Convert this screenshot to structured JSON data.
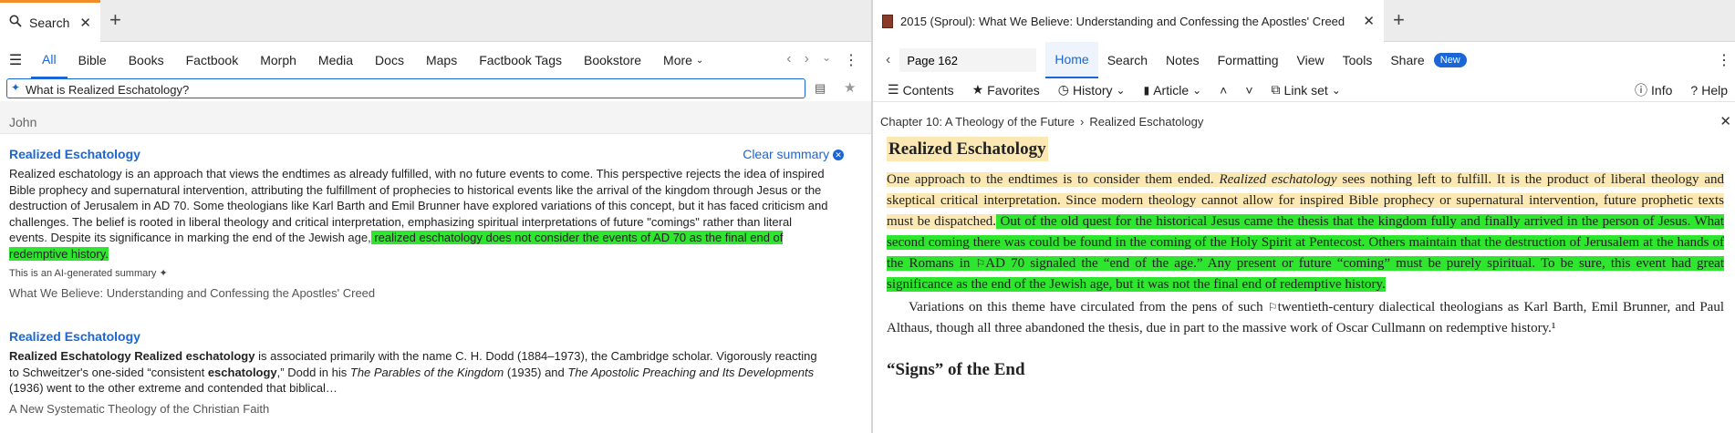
{
  "left_panel": {
    "tab": {
      "title": "Search"
    },
    "nav": {
      "items": [
        "All",
        "Bible",
        "Books",
        "Factbook",
        "Morph",
        "Media",
        "Docs",
        "Maps",
        "Factbook Tags",
        "Bookstore"
      ],
      "more": "More"
    },
    "search": {
      "value": "What is Realized Eschatology?"
    },
    "prev_result_fragment": "John",
    "summary": {
      "title": "Realized Eschatology",
      "clear_label": "Clear summary",
      "body": "Realized eschatology is an approach that views the endtimes as already fulfilled, with no future events to come. This perspective rejects the idea of inspired Bible prophecy and supernatural intervention, attributing the fulfillment of prophecies to historical events like the arrival of the kingdom through Jesus or the destruction of Jerusalem in AD 70. Some theologians like Karl Barth and Emil Brunner have explored variations of this concept, but it has faced criticism and challenges. The belief is rooted in liberal theology and critical interpretation, emphasizing spiritual interpretations of future \"comings\" rather than literal events. Despite its significance in marking the end of the Jewish age,",
      "body_highlight": " realized eschatology does not consider the events of AD 70 as the final end of redemptive history.",
      "ai_note": "This is an AI-generated summary",
      "source": "What We Believe: Understanding and Confessing the Apostles' Creed"
    },
    "result2": {
      "title": "Realized Eschatology",
      "bold_lead": "Realized Eschatology Realized eschatology",
      "text1": " is associated primarily with the name C. H. Dodd (1884–1973), the Cambridge scholar. Vigorously reacting to Schweitzer's one-sided “consistent ",
      "bold2": "eschatology",
      "text2": ",” Dodd in his ",
      "italic1": "The Parables of the Kingdom",
      "text3": " (1935) and ",
      "italic2": "The Apostolic Preaching and Its Developments",
      "text4": " (1936) went to the other extreme and contended that biblical…",
      "source": "A New Systematic Theology of the Christian Faith"
    }
  },
  "right_panel": {
    "tab": {
      "title": "2015 (Sproul): What We Believe: Understanding and Confessing the Apostles' Creed"
    },
    "page_field": "Page 162",
    "menu": [
      "Home",
      "Search",
      "Notes",
      "Formatting",
      "View",
      "Tools",
      "Share"
    ],
    "new_badge": "New",
    "toolbar": {
      "contents": "Contents",
      "favorites": "Favorites",
      "history": "History",
      "article": "Article",
      "link_set": "Link set",
      "info": "Info",
      "help": "Help"
    },
    "breadcrumb": {
      "chapter": "Chapter 10: A Theology of the Future",
      "section": "Realized Eschatology"
    },
    "content": {
      "heading": "Realized Eschatology",
      "p1_y1": "One approach to the endtimes is to consider them ended. ",
      "p1_y_italic": "Realized eschatology",
      "p1_y2": " sees nothing left to fulfill. It is the product of liberal theology and skeptical critical interpretation. Since modern theology cannot allow for inspired Bible prophecy or supernatural intervention, future prophetic texts must be dispatched.",
      "p1_g1": " Out of the old quest for the historical Jesus came the thesis that the king­dom fully and finally arrived in the person of Jesus. What second coming there was could be found in the coming of the Holy Spirit at Pentecost. Others maintain that the destruction of Jerusalem at the hands of the Romans in ",
      "p1_g2": "AD 70 signaled the “end of the age.” Any present or future “coming” must be purely spiritual. To be sure, this event had great significance as the end of the Jewish age, but it was not the final end of redemptive history.",
      "p2_a": "Variations on this theme have circulated from the pens of such ",
      "p2_b": "twentieth-century dialectical theologians as Karl Barth, Emil Brunner, and Paul Althaus, though all three abandoned the thesis, due in part to the massive work of Oscar Cullmann on redemp­tive history.¹",
      "subheading": "“Signs” of the End"
    }
  },
  "icons": [
    "search-icon",
    "close-icon",
    "plus-icon",
    "hamburger-icon",
    "chevron-left-icon",
    "chevron-right-icon",
    "kebab-icon",
    "spark-icon",
    "list-icon",
    "star-icon",
    "book-icon",
    "flag-icon",
    "info-icon",
    "help-icon"
  ]
}
